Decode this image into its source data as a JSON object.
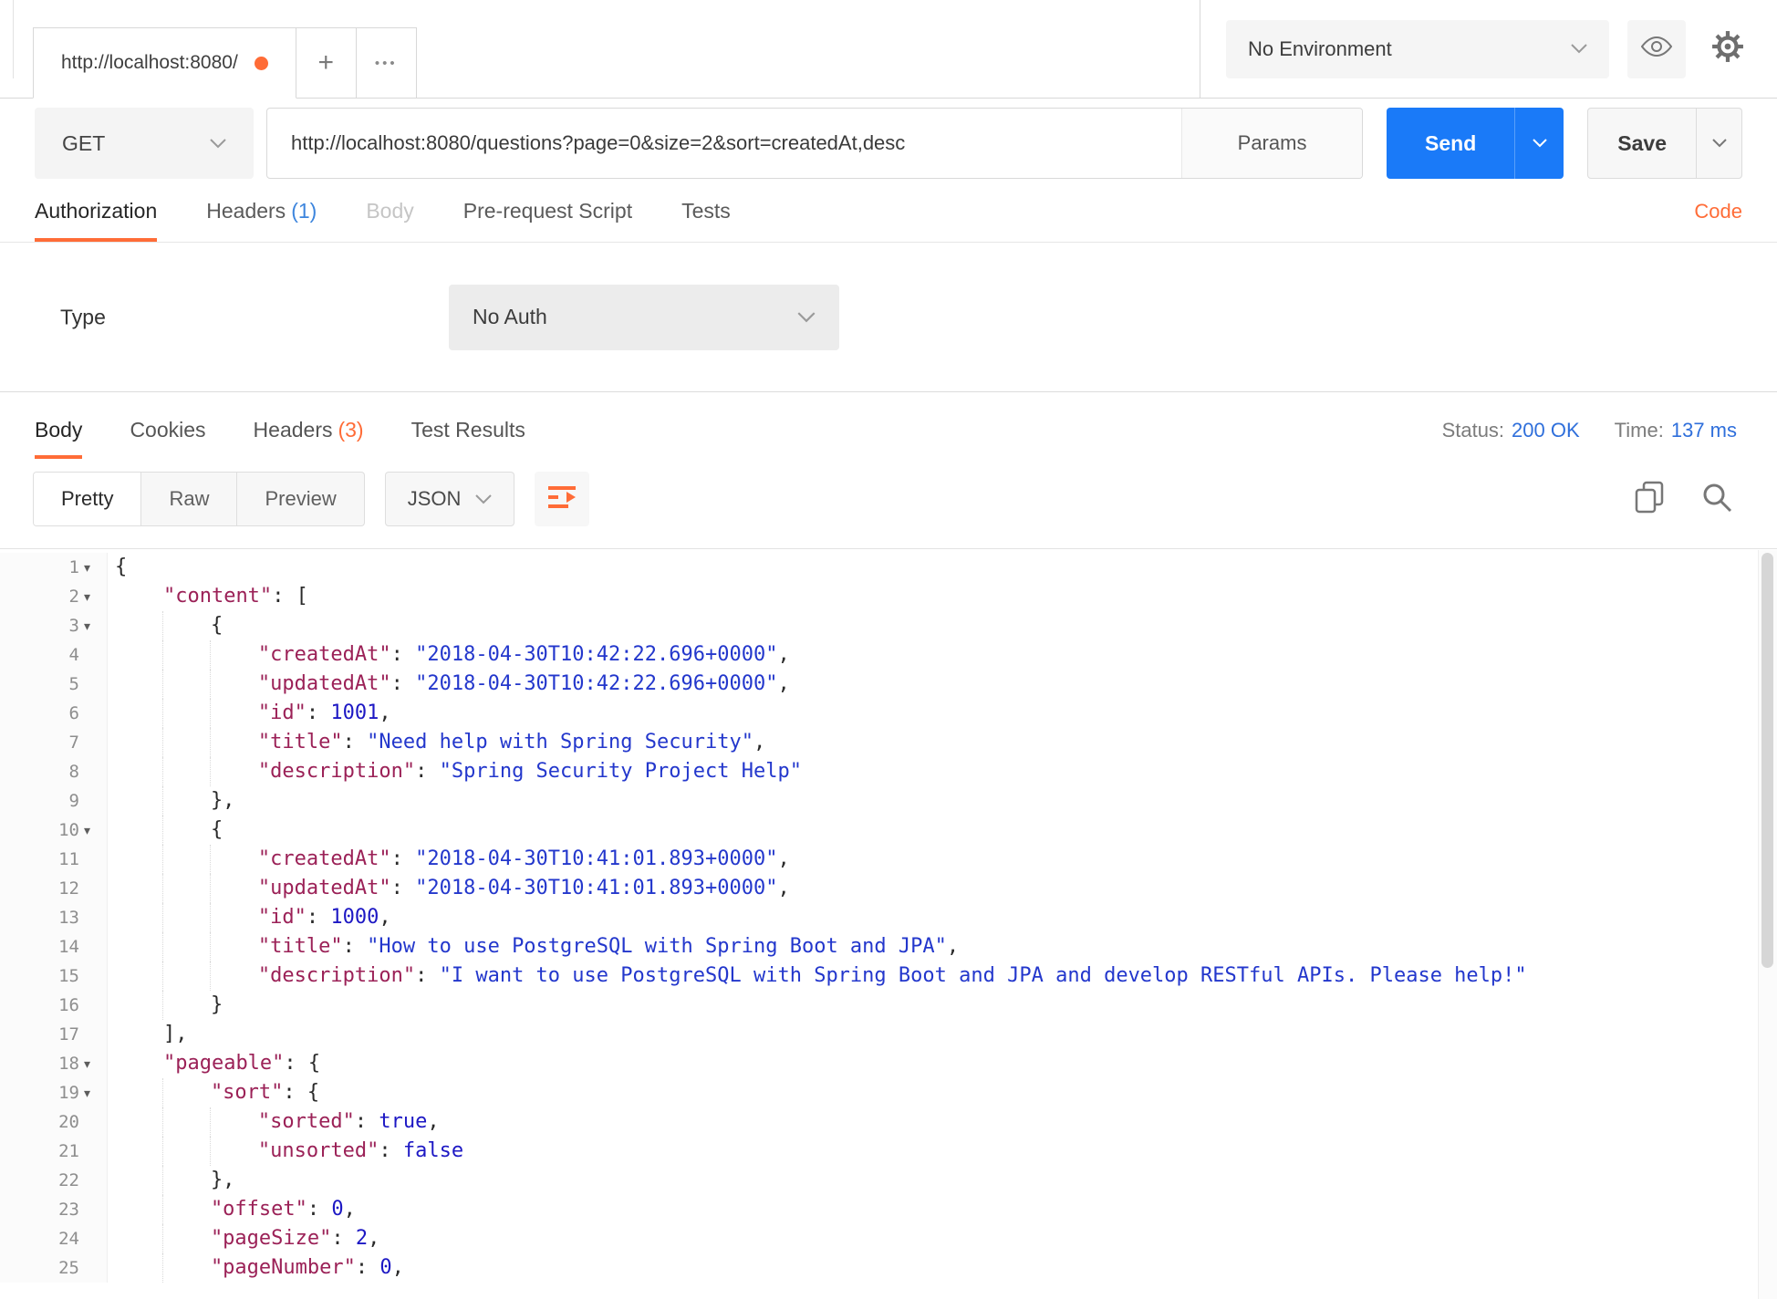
{
  "colors": {
    "accent_orange": "#ff6c37",
    "send_blue": "#1a7af8",
    "link_blue": "#2f6fdb",
    "key": "#9b2157",
    "string": "#2337cc",
    "number": "#1d18c4",
    "count_blue": "#3d85dd"
  },
  "icons": {
    "plus": "+",
    "more": "•••",
    "fold": "▾"
  },
  "topbar": {
    "tab_title": "http://localhost:8080/",
    "environment": "No Environment"
  },
  "request": {
    "method": "GET",
    "url": "http://localhost:8080/questions?page=0&size=2&sort=createdAt,desc",
    "params_label": "Params",
    "send_label": "Send",
    "save_label": "Save",
    "tabs": [
      "Authorization",
      "Headers",
      "Body",
      "Pre-request Script",
      "Tests"
    ],
    "headers_count": "(1)",
    "code_link": "Code",
    "auth_type_label": "Type",
    "auth_type_value": "No Auth"
  },
  "response": {
    "tabs": [
      "Body",
      "Cookies",
      "Headers",
      "Test Results"
    ],
    "headers_count": "(3)",
    "status_label": "Status:",
    "status_value": "200 OK",
    "time_label": "Time:",
    "time_value": "137 ms",
    "view_modes": [
      "Pretty",
      "Raw",
      "Preview"
    ],
    "format": "JSON"
  },
  "code": {
    "lines": [
      {
        "n": 1,
        "fold": true,
        "indent": 0,
        "toks": [
          [
            "p",
            "{"
          ]
        ]
      },
      {
        "n": 2,
        "fold": true,
        "indent": 1,
        "toks": [
          [
            "k",
            "\"content\""
          ],
          [
            "p",
            ": ["
          ]
        ]
      },
      {
        "n": 3,
        "fold": true,
        "indent": 2,
        "toks": [
          [
            "p",
            "{"
          ]
        ]
      },
      {
        "n": 4,
        "indent": 3,
        "toks": [
          [
            "k",
            "\"createdAt\""
          ],
          [
            "p",
            ": "
          ],
          [
            "s",
            "\"2018-04-30T10:42:22.696+0000\""
          ],
          [
            "p",
            ","
          ]
        ]
      },
      {
        "n": 5,
        "indent": 3,
        "toks": [
          [
            "k",
            "\"updatedAt\""
          ],
          [
            "p",
            ": "
          ],
          [
            "s",
            "\"2018-04-30T10:42:22.696+0000\""
          ],
          [
            "p",
            ","
          ]
        ]
      },
      {
        "n": 6,
        "indent": 3,
        "toks": [
          [
            "k",
            "\"id\""
          ],
          [
            "p",
            ": "
          ],
          [
            "n",
            "1001"
          ],
          [
            "p",
            ","
          ]
        ]
      },
      {
        "n": 7,
        "indent": 3,
        "toks": [
          [
            "k",
            "\"title\""
          ],
          [
            "p",
            ": "
          ],
          [
            "s",
            "\"Need help with Spring Security\""
          ],
          [
            "p",
            ","
          ]
        ]
      },
      {
        "n": 8,
        "indent": 3,
        "toks": [
          [
            "k",
            "\"description\""
          ],
          [
            "p",
            ": "
          ],
          [
            "s",
            "\"Spring Security Project Help\""
          ]
        ]
      },
      {
        "n": 9,
        "indent": 2,
        "toks": [
          [
            "p",
            "},"
          ]
        ]
      },
      {
        "n": 10,
        "fold": true,
        "indent": 2,
        "toks": [
          [
            "p",
            "{"
          ]
        ]
      },
      {
        "n": 11,
        "indent": 3,
        "toks": [
          [
            "k",
            "\"createdAt\""
          ],
          [
            "p",
            ": "
          ],
          [
            "s",
            "\"2018-04-30T10:41:01.893+0000\""
          ],
          [
            "p",
            ","
          ]
        ]
      },
      {
        "n": 12,
        "indent": 3,
        "toks": [
          [
            "k",
            "\"updatedAt\""
          ],
          [
            "p",
            ": "
          ],
          [
            "s",
            "\"2018-04-30T10:41:01.893+0000\""
          ],
          [
            "p",
            ","
          ]
        ]
      },
      {
        "n": 13,
        "indent": 3,
        "toks": [
          [
            "k",
            "\"id\""
          ],
          [
            "p",
            ": "
          ],
          [
            "n",
            "1000"
          ],
          [
            "p",
            ","
          ]
        ]
      },
      {
        "n": 14,
        "indent": 3,
        "toks": [
          [
            "k",
            "\"title\""
          ],
          [
            "p",
            ": "
          ],
          [
            "s",
            "\"How to use PostgreSQL with Spring Boot and JPA\""
          ],
          [
            "p",
            ","
          ]
        ]
      },
      {
        "n": 15,
        "indent": 3,
        "toks": [
          [
            "k",
            "\"description\""
          ],
          [
            "p",
            ": "
          ],
          [
            "s",
            "\"I want to use PostgreSQL with Spring Boot and JPA and develop RESTful APIs. Please help!\""
          ]
        ]
      },
      {
        "n": 16,
        "indent": 2,
        "toks": [
          [
            "p",
            "}"
          ]
        ]
      },
      {
        "n": 17,
        "indent": 1,
        "toks": [
          [
            "p",
            "],"
          ]
        ]
      },
      {
        "n": 18,
        "fold": true,
        "indent": 1,
        "toks": [
          [
            "k",
            "\"pageable\""
          ],
          [
            "p",
            ": {"
          ]
        ]
      },
      {
        "n": 19,
        "fold": true,
        "indent": 2,
        "toks": [
          [
            "k",
            "\"sort\""
          ],
          [
            "p",
            ": {"
          ]
        ]
      },
      {
        "n": 20,
        "indent": 3,
        "toks": [
          [
            "k",
            "\"sorted\""
          ],
          [
            "p",
            ": "
          ],
          [
            "b",
            "true"
          ],
          [
            "p",
            ","
          ]
        ]
      },
      {
        "n": 21,
        "indent": 3,
        "toks": [
          [
            "k",
            "\"unsorted\""
          ],
          [
            "p",
            ": "
          ],
          [
            "b",
            "false"
          ]
        ]
      },
      {
        "n": 22,
        "indent": 2,
        "toks": [
          [
            "p",
            "},"
          ]
        ]
      },
      {
        "n": 23,
        "indent": 2,
        "toks": [
          [
            "k",
            "\"offset\""
          ],
          [
            "p",
            ": "
          ],
          [
            "n",
            "0"
          ],
          [
            "p",
            ","
          ]
        ]
      },
      {
        "n": 24,
        "indent": 2,
        "toks": [
          [
            "k",
            "\"pageSize\""
          ],
          [
            "p",
            ": "
          ],
          [
            "n",
            "2"
          ],
          [
            "p",
            ","
          ]
        ]
      },
      {
        "n": 25,
        "indent": 2,
        "toks": [
          [
            "k",
            "\"pageNumber\""
          ],
          [
            "p",
            ": "
          ],
          [
            "n",
            "0"
          ],
          [
            "p",
            ","
          ]
        ]
      }
    ]
  }
}
